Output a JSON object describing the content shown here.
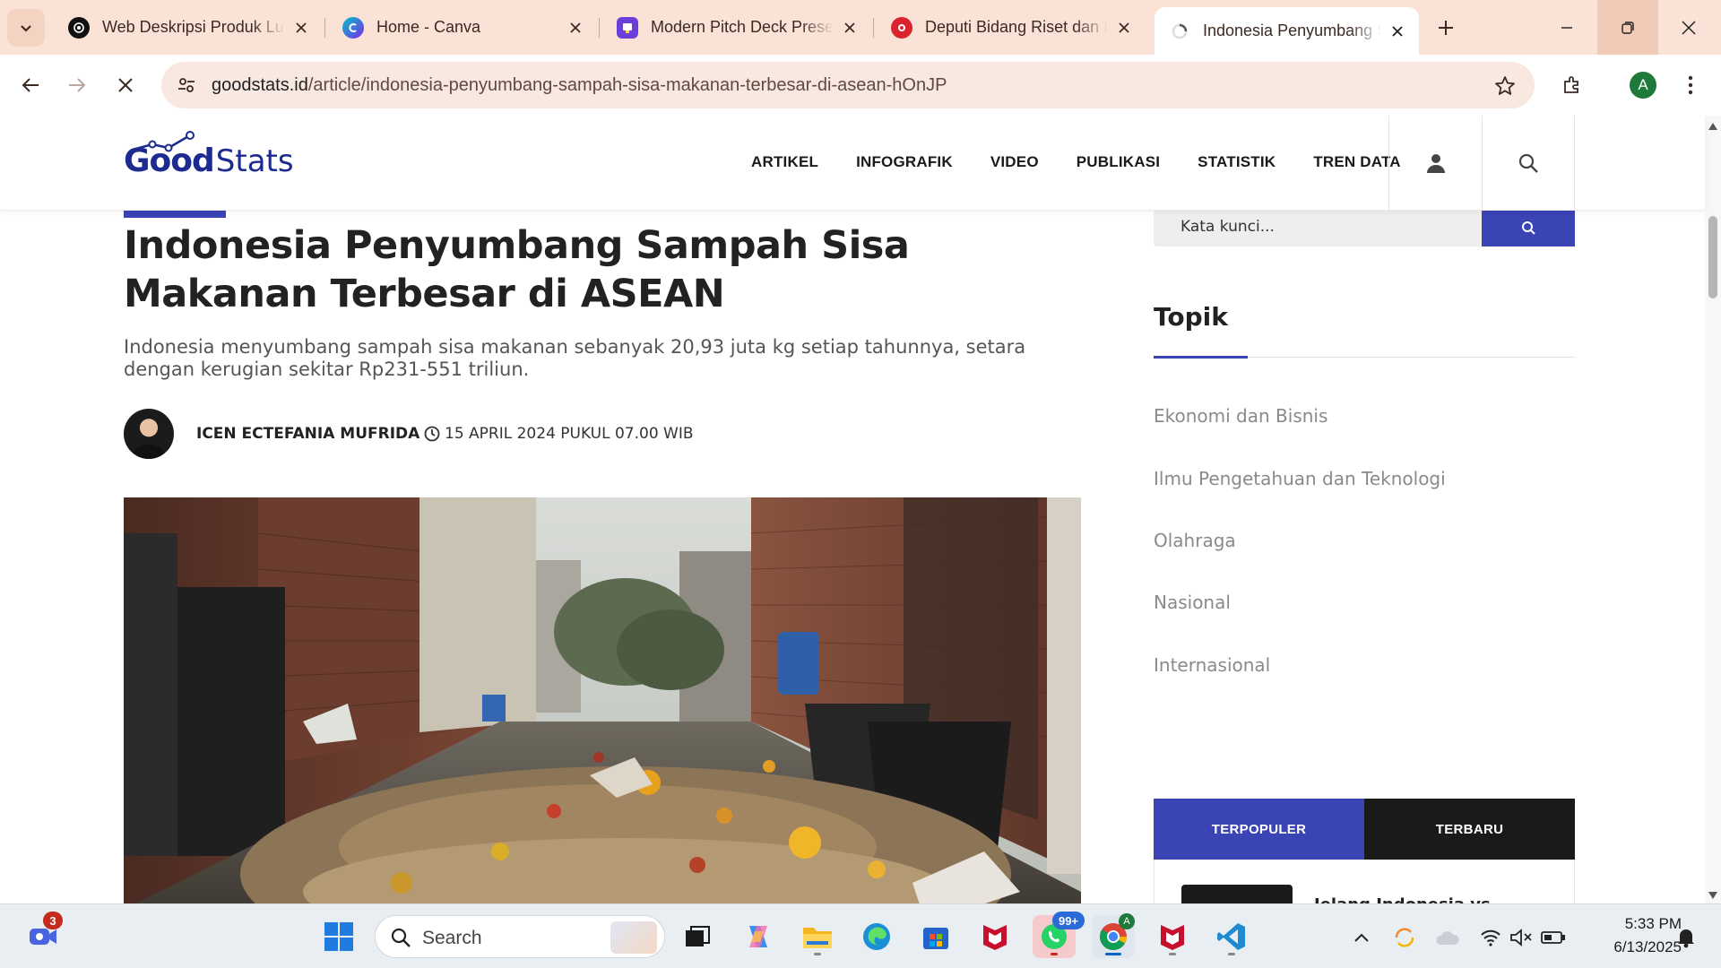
{
  "browser": {
    "tabs": [
      {
        "title": "Web Deskripsi Produk Lu",
        "favicon": "openai-icon"
      },
      {
        "title": "Home - Canva",
        "favicon": "canva-icon"
      },
      {
        "title": "Modern Pitch Deck Prese",
        "favicon": "pitch-icon"
      },
      {
        "title": "Deputi Bidang Riset dan I",
        "favicon": "brin-icon"
      },
      {
        "title": "Indonesia Penyumbang S",
        "favicon": "loading-icon",
        "active": true
      }
    ],
    "url_domain": "goodstats.id",
    "url_path": "/article/indonesia-penyumbang-sampah-sisa-makanan-terbesar-di-asean-hOnJP",
    "profile_initial": "A",
    "accent": "#fbe2d6"
  },
  "site": {
    "logo_good": "Good",
    "logo_stats": "Stats",
    "brand_color": "#1d2a8f",
    "nav": [
      "ARTIKEL",
      "INFOGRAFIK",
      "VIDEO",
      "PUBLIKASI",
      "STATISTIK",
      "TREN DATA"
    ]
  },
  "article": {
    "title": "Indonesia Penyumbang Sampah Sisa Makanan Terbesar di ASEAN",
    "lead": "Indonesia menyumbang sampah sisa makanan sebanyak 20,93 juta kg setiap tahunnya, setara dengan kerugian sekitar Rp231-551 triliun.",
    "author": "ICEN ECTEFANIA MUFRIDA",
    "date": "15 APRIL 2024 PUKUL 07.00 WIB"
  },
  "sidebar": {
    "search_placeholder": "Kata kunci...",
    "topik_title": "Topik",
    "topics": [
      "Ekonomi dan Bisnis",
      "Ilmu Pengetahuan dan Teknologi",
      "Olahraga",
      "Nasional",
      "Internasional"
    ],
    "tab_popular": "TERPOPULER",
    "tab_latest": "TERBARU",
    "popular_first_title": "Jelang Indonesia vs",
    "accent": "#3b44b5"
  },
  "taskbar": {
    "search_label": "Search",
    "notif_badge": "3",
    "whatsapp_badge": "99+",
    "time": "5:33 PM",
    "date": "6/13/2025"
  }
}
